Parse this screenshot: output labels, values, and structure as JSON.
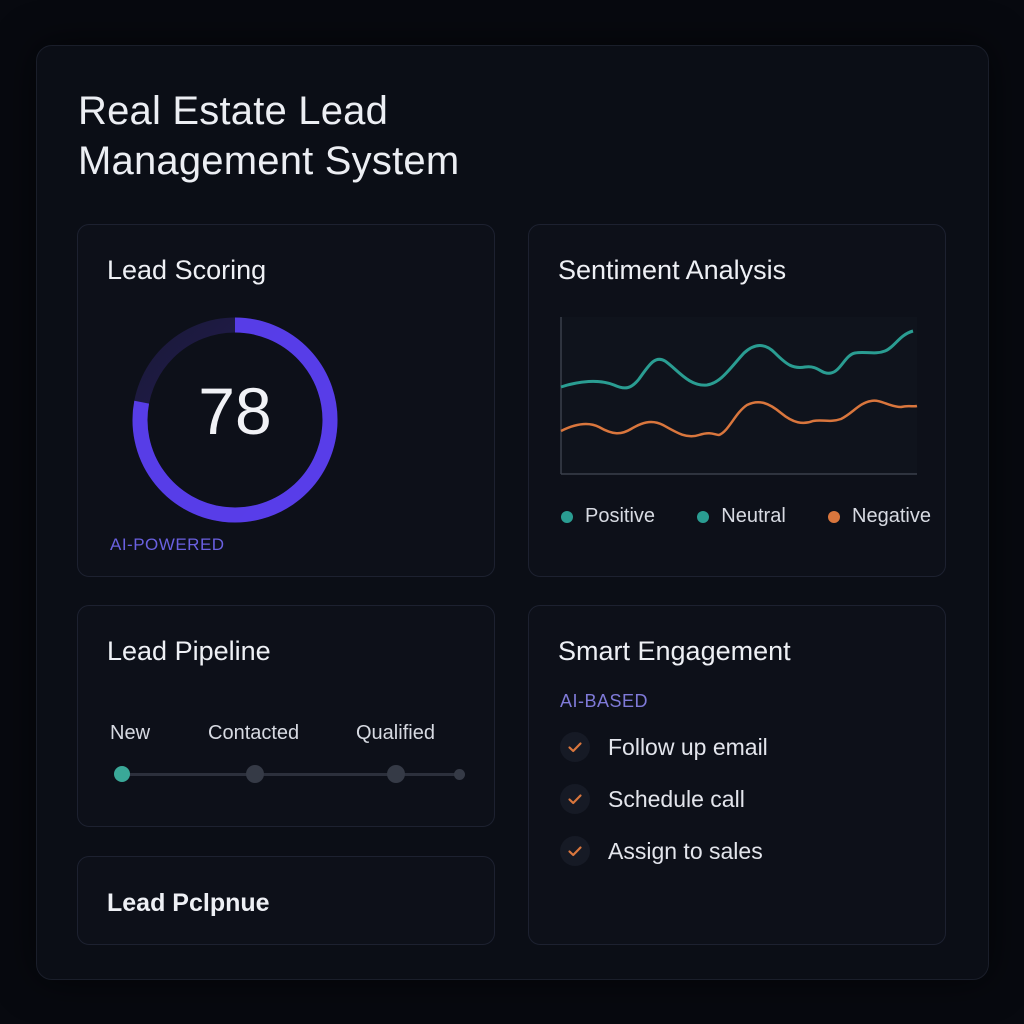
{
  "page": {
    "title": "Real Estate Lead Management System"
  },
  "lead_scoring": {
    "title": "Lead Scoring",
    "score": "78",
    "score_fraction": 0.78,
    "badge": "AI-POWERED",
    "accent": "#5b3ff0"
  },
  "sentiment": {
    "title": "Sentiment Analysis",
    "legend": [
      {
        "label": "Positive",
        "color": "#2a9d92"
      },
      {
        "label": "Neutral",
        "color": "#2a9d92"
      },
      {
        "label": "Negative",
        "color": "#d9763d"
      }
    ],
    "series_colors": {
      "upper": "#2a9d92",
      "lower": "#d9763d"
    }
  },
  "pipeline": {
    "title": "Lead Pipeline",
    "stages": [
      "New",
      "Contacted",
      "Qualified"
    ],
    "active_color": "#3aa898"
  },
  "pipeline_secondary": {
    "title": "Lead Pclpnue"
  },
  "engagement": {
    "title": "Smart Engagement",
    "subtitle": "AI-BASED",
    "tasks": [
      "Follow up email",
      "Schedule call",
      "Assign to sales"
    ],
    "check_color": "#d9763d"
  }
}
